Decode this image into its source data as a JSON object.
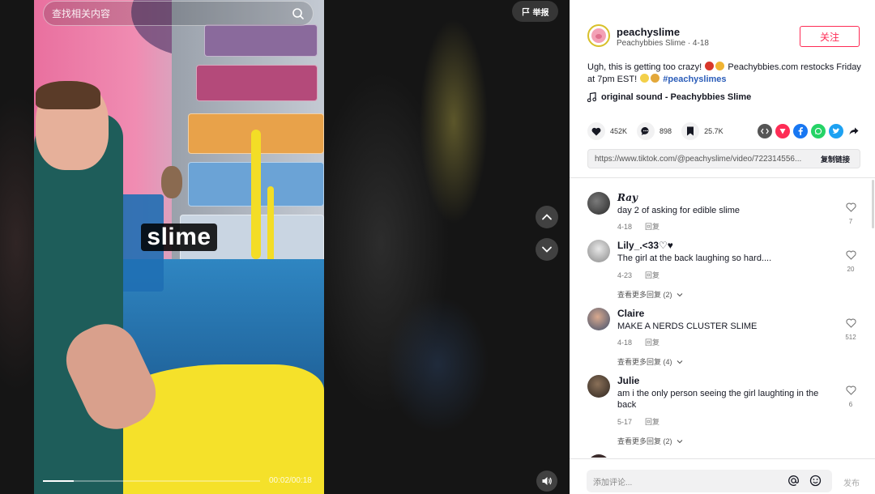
{
  "search": {
    "placeholder": "查找相关内容"
  },
  "report": {
    "label": "举报"
  },
  "video": {
    "caption": "slime",
    "current_time": "00:02",
    "duration": "00:18",
    "time_display": "00:02/00:18",
    "progress": 0.14
  },
  "author": {
    "username": "peachyslime",
    "display_name": "Peachybbies Slime",
    "date": "4-18",
    "meta": "Peachybbies Slime · 4-18"
  },
  "follow_button": {
    "label": "关注"
  },
  "description": {
    "text_part1": "Ugh, this is getting too crazy!",
    "text_part2": "Peachybbies.com restocks Friday at 7pm EST!",
    "hashtag": "#peachyslimes"
  },
  "sound": {
    "label": "original sound - Peachybbies Slime"
  },
  "stats": {
    "likes": "452K",
    "comments": "898",
    "saves": "25.7K"
  },
  "share_icons": [
    "embed-icon",
    "tiktok-share-icon",
    "facebook-icon",
    "whatsapp-icon",
    "twitter-icon",
    "forward-icon"
  ],
  "link": {
    "url": "https://www.tiktok.com/@peachyslime/video/722314556...",
    "copy_label": "复制链接"
  },
  "comments": [
    {
      "user": "Ray",
      "text": "day 2 of asking for edible slime",
      "date": "4-18",
      "reply": "回复",
      "likes": "7",
      "more": ""
    },
    {
      "user": "Lily_.<33♡♥",
      "text": "The girl at the back laughing so hard....",
      "date": "4-23",
      "reply": "回复",
      "likes": "20",
      "more": "查看更多回复 (2)"
    },
    {
      "user": "Claire",
      "text": "MAKE A NERDS CLUSTER SLIME",
      "date": "4-18",
      "reply": "回复",
      "likes": "512",
      "more": "查看更多回复 (4)"
    },
    {
      "user": "Julie",
      "text": "am i the only person seeing the girl laughting in the back",
      "date": "5-17",
      "reply": "回复",
      "likes": "6",
      "more": "查看更多回复 (2)"
    }
  ],
  "comment_box": {
    "placeholder": "添加评论...",
    "post_label": "发布"
  },
  "colors": {
    "accent": "#fe2c55",
    "hashtag": "#2b5db9",
    "text": "#161823"
  }
}
